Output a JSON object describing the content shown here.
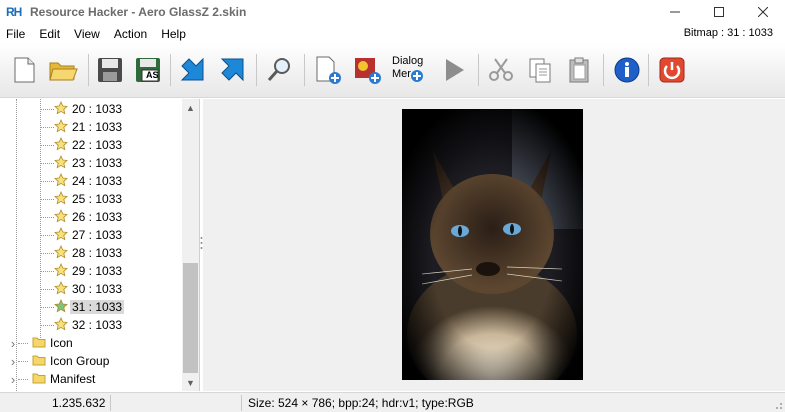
{
  "window": {
    "logo_text": "RH",
    "title": "Resource Hacker - Aero GlassZ 2.skin"
  },
  "menu": {
    "items": [
      "File",
      "Edit",
      "View",
      "Action",
      "Help"
    ],
    "bitmap_readout": "Bitmap : 31 : 1033"
  },
  "toolbar": {
    "buttons": [
      "new-file",
      "open-folder",
      "save",
      "save-as",
      "compile",
      "script",
      "find",
      "add-resource",
      "add-image",
      "dialog-menu",
      "run",
      "cut",
      "copy",
      "paste",
      "about",
      "exit"
    ],
    "save_as_label": "AS",
    "dialog_menu_label_line1": "Dialog",
    "dialog_menu_label_line2": "Mer"
  },
  "tree": {
    "bitmap_items": [
      {
        "label": "20 : 1033"
      },
      {
        "label": "21 : 1033"
      },
      {
        "label": "22 : 1033"
      },
      {
        "label": "23 : 1033"
      },
      {
        "label": "24 : 1033"
      },
      {
        "label": "25 : 1033"
      },
      {
        "label": "26 : 1033"
      },
      {
        "label": "27 : 1033"
      },
      {
        "label": "28 : 1033"
      },
      {
        "label": "29 : 1033"
      },
      {
        "label": "30 : 1033"
      },
      {
        "label": "31 : 1033",
        "selected": true
      },
      {
        "label": "32 : 1033"
      }
    ],
    "groups": [
      {
        "label": "Icon"
      },
      {
        "label": "Icon Group"
      },
      {
        "label": "Manifest"
      }
    ]
  },
  "status": {
    "left": "1.235.632",
    "right": "Size: 524 × 786;  bpp:24;  hdr:v1;  type:RGB"
  },
  "colors": {
    "star_fill": "#f7e27a",
    "star_selected_fill": "#7cc47c",
    "folder_fill": "#f5d66b",
    "about_blue": "#1f5fc9",
    "exit_red": "#e0492f"
  }
}
